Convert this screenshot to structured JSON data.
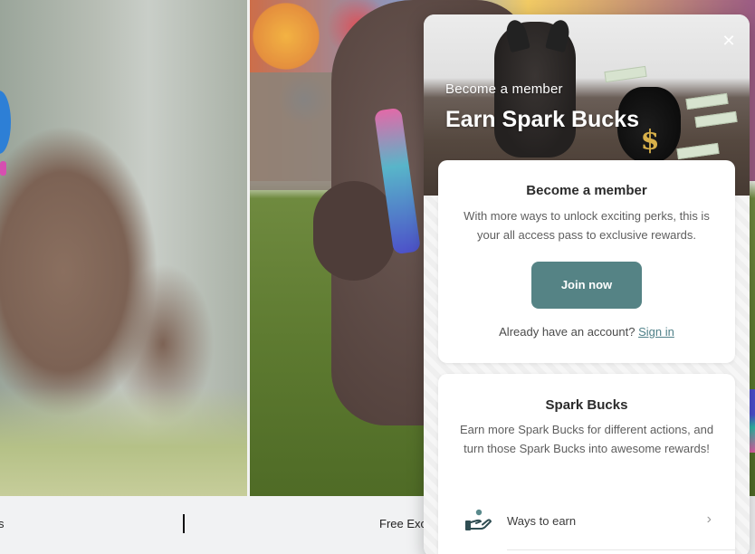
{
  "panel": {
    "hero": {
      "eyebrow": "Become a member",
      "title": "Earn Spark Bucks",
      "close_icon": "close-icon"
    },
    "member_card": {
      "heading": "Become a member",
      "description": "With more ways to unlock exciting perks, this is your all access pass to exclusive rewards.",
      "join_label": "Join now",
      "signin_prompt": "Already have an account?",
      "signin_link": "Sign in"
    },
    "bucks_card": {
      "heading": "Spark Bucks",
      "description": "Earn more Spark Bucks for different actions, and turn those Spark Bucks into awesome rewards!",
      "ways_label": "Ways to earn",
      "ways_icon": "hand-coin-icon",
      "chevron_icon": "chevron-right-icon"
    }
  },
  "bottom_strip": {
    "left_text": "s",
    "right_text": "Free Exc"
  },
  "colors": {
    "accent": "#558385",
    "link": "#4f8088",
    "strip_bg": "#f1f2f3"
  }
}
